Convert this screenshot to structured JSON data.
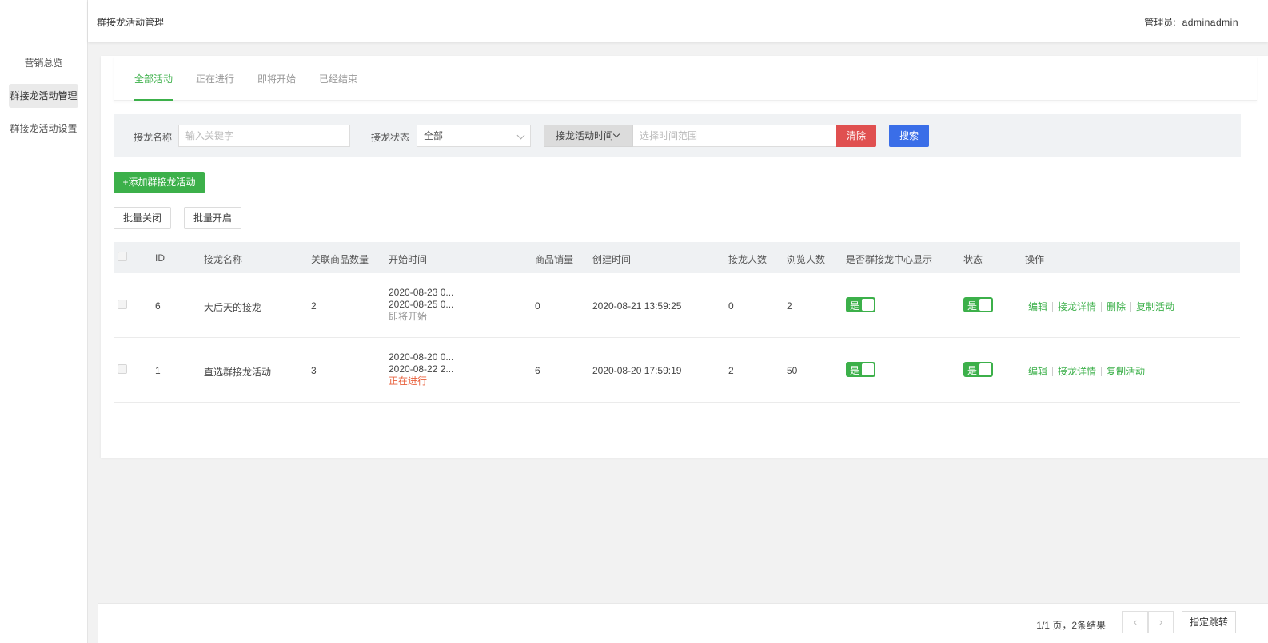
{
  "sidebar": {
    "items": [
      {
        "label": "营销总览"
      },
      {
        "label": "群接龙活动管理"
      },
      {
        "label": "群接龙活动设置"
      }
    ]
  },
  "header": {
    "title": "群接龙活动管理",
    "admin_label": "管理员:",
    "admin_name": "adminadmin"
  },
  "tabs": [
    {
      "label": "全部活动"
    },
    {
      "label": "正在进行"
    },
    {
      "label": "即将开始"
    },
    {
      "label": "已经结束"
    }
  ],
  "filter": {
    "name_label": "接龙名称",
    "name_placeholder": "输入关键字",
    "status_label": "接龙状态",
    "status_value": "全部",
    "date_type": "接龙活动时间",
    "date_placeholder": "选择时间范围",
    "clear_label": "清除",
    "search_label": "搜索"
  },
  "actions": {
    "add_label": "+添加群接龙活动",
    "batch_close_label": "批量关闭",
    "batch_open_label": "批量开启"
  },
  "table": {
    "columns": {
      "id": "ID",
      "name": "接龙名称",
      "product_count": "关联商品数量",
      "start_time": "开始时间",
      "sales": "商品销量",
      "created": "创建时间",
      "participants": "接龙人数",
      "views": "浏览人数",
      "show_center": "是否群接龙中心显示",
      "status": "状态",
      "ops": "操作"
    },
    "rows": [
      {
        "id": "6",
        "name": "大后天的接龙",
        "product_count": "2",
        "start": "2020-08-23 0...",
        "end": "2020-08-25 0...",
        "state": "即将开始",
        "sales": "0",
        "created": "2020-08-21 13:59:25",
        "participants": "0",
        "views": "2",
        "show_center": "是",
        "status": "是",
        "ops": [
          "编辑",
          "接龙详情",
          "删除",
          "复制活动"
        ]
      },
      {
        "id": "1",
        "name": "直选群接龙活动",
        "product_count": "3",
        "start": "2020-08-20 0...",
        "end": "2020-08-22 2...",
        "state": "正在进行",
        "sales": "6",
        "created": "2020-08-20 17:59:19",
        "participants": "2",
        "views": "50",
        "show_center": "是",
        "status": "是",
        "ops": [
          "编辑",
          "接龙详情",
          "复制活动"
        ]
      }
    ]
  },
  "pagination": {
    "info": "1/1 页，2条结果",
    "prev_icon": "‹",
    "next_icon": "›",
    "jump_label": "指定跳转"
  },
  "colors": {
    "accent": "#3cb04a",
    "danger": "#e05050",
    "primary": "#3a6ee8",
    "ongoing": "#e8603c"
  }
}
